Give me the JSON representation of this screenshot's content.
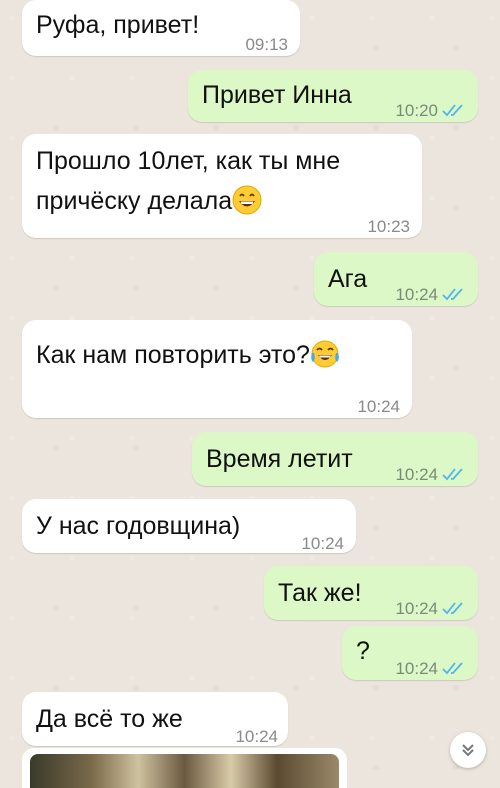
{
  "messages": [
    {
      "direction": "in",
      "text": "Руфа, привет!",
      "time": "09:13"
    },
    {
      "direction": "out",
      "text": "Привет Инна",
      "time": "10:20",
      "status": "read"
    },
    {
      "direction": "in",
      "text_line1": "Прошло 10лет, как ты мне",
      "text_line2": "причёску делала",
      "emoji": "grinning-face",
      "time": "10:23"
    },
    {
      "direction": "out",
      "text": "Ага",
      "time": "10:24",
      "status": "read"
    },
    {
      "direction": "in",
      "text": "Как нам повторить это?",
      "emoji": "tears-of-joy-face",
      "time": "10:24"
    },
    {
      "direction": "out",
      "text": "Время летит",
      "time": "10:24",
      "status": "read"
    },
    {
      "direction": "in",
      "text": "У нас годовщина)",
      "time": "10:24"
    },
    {
      "direction": "out",
      "text": "Так же!",
      "time": "10:24",
      "status": "read"
    },
    {
      "direction": "out",
      "text": "?",
      "time": "10:24",
      "status": "read"
    },
    {
      "direction": "in",
      "text": "Да всё то же",
      "time": "10:24"
    },
    {
      "direction": "in",
      "type": "image"
    }
  ],
  "colors": {
    "chat_background": "#ece5dd",
    "incoming_bubble": "#ffffff",
    "outgoing_bubble": "#dcf8c6",
    "read_ticks": "#4fb6ec"
  },
  "scroll_button": {
    "icon": "double-chevron-down-icon"
  }
}
